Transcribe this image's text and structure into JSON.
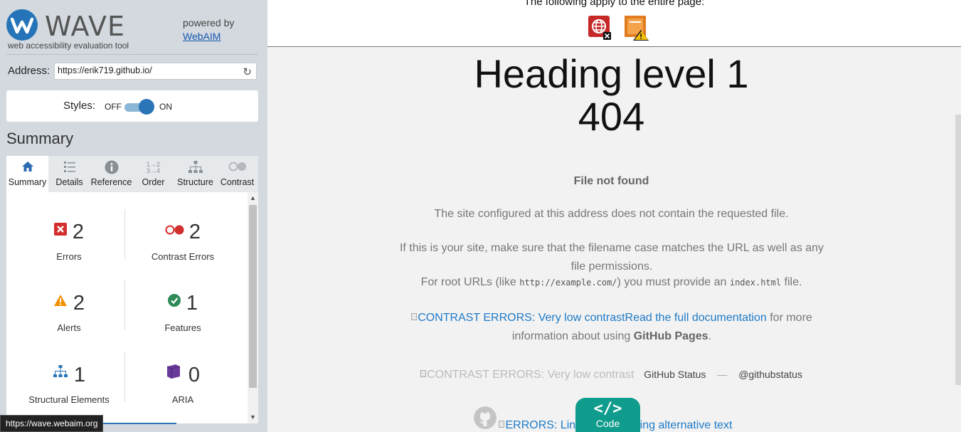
{
  "branding": {
    "logo_text": "WAVE",
    "tagline": "web accessibility evaluation tool",
    "powered_by": "powered by",
    "webaim_link": "WebAIM"
  },
  "address": {
    "label": "Address:",
    "value": "https://erik719.github.io/"
  },
  "styles": {
    "label": "Styles:",
    "off": "OFF",
    "on": "ON",
    "state": "on"
  },
  "summary": {
    "heading": "Summary",
    "tabs": [
      {
        "label": "Summary",
        "icon": "home-icon",
        "active": true
      },
      {
        "label": "Details",
        "icon": "list-icon",
        "active": false
      },
      {
        "label": "Reference",
        "icon": "info-icon",
        "active": false
      },
      {
        "label": "Order",
        "icon": "order-icon",
        "active": false
      },
      {
        "label": "Structure",
        "icon": "structure-icon",
        "active": false
      },
      {
        "label": "Contrast",
        "icon": "contrast-icon",
        "active": false
      }
    ],
    "items": [
      {
        "count": "2",
        "label": "Errors",
        "icon": "error-icon",
        "color": "#d32f2f"
      },
      {
        "count": "2",
        "label": "Contrast Errors",
        "icon": "contrast-error-icon",
        "color": "#d32f2f"
      },
      {
        "count": "2",
        "label": "Alerts",
        "icon": "alert-icon",
        "color": "#f29100"
      },
      {
        "count": "1",
        "label": "Features",
        "icon": "feature-icon",
        "color": "#2e8b57"
      },
      {
        "count": "1",
        "label": "Structural Elements",
        "icon": "structure-icon",
        "color": "#2573b8"
      },
      {
        "count": "0",
        "label": "ARIA",
        "icon": "aria-icon",
        "color": "#6a3a9b"
      }
    ]
  },
  "status_tooltip": "https://wave.webaim.org",
  "page": {
    "notice": "The following apply to the entire page:",
    "heading_marker": "Heading level 1",
    "heading_text": "404",
    "file_not_found": "File not found",
    "p1": "The site configured at this address does not contain the requested file.",
    "p2": "If this is your site, make sure that the filename case matches the URL as well as any file permissions.",
    "p3_pre": "For root URLs (like ",
    "p3_code1": "http://example.com/",
    "p3_mid": ") you must provide an ",
    "p3_code2": "index.html",
    "p3_post": " file.",
    "contrast_alt": "CONTRAST ERRORS: Very low contrast",
    "doc_link": "Read the full documentation",
    "p4_mid": " for more information about using ",
    "github_pages": "GitHub Pages",
    "p4_end": ".",
    "footer_contrast_alt": "CONTRAST ERRORS: Very low contrast",
    "github_status": "GitHub Status",
    "dash": "—",
    "githubstatus": "@githubstatus",
    "bottom_alt_start": "ERRORS: Lin",
    "bottom_alt_end": "nissing alternative text",
    "code_label": "Code"
  }
}
